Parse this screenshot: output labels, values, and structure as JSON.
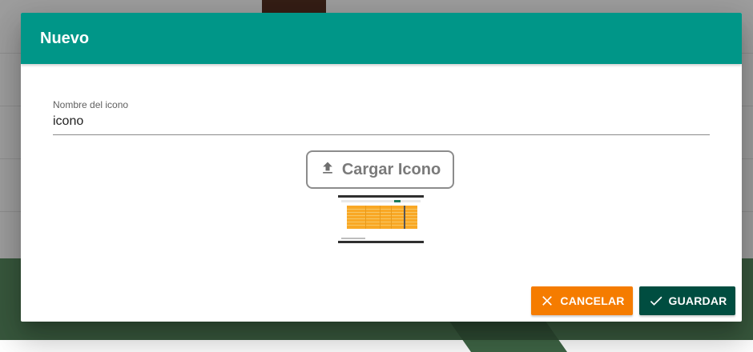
{
  "dialog": {
    "title": "Nuevo",
    "field": {
      "label": "Nombre del icono",
      "value": "icono"
    },
    "upload_button": {
      "label": "Cargar Icono",
      "icon": "upload-icon"
    },
    "actions": {
      "cancel": {
        "label": "CANCELAR",
        "icon": "close-icon",
        "color": "#f57c00"
      },
      "save": {
        "label": "GUARDAR",
        "icon": "check-icon",
        "color": "#004d40"
      }
    }
  },
  "colors": {
    "header": "#009688",
    "cancel": "#f57c00",
    "save": "#004d40"
  }
}
